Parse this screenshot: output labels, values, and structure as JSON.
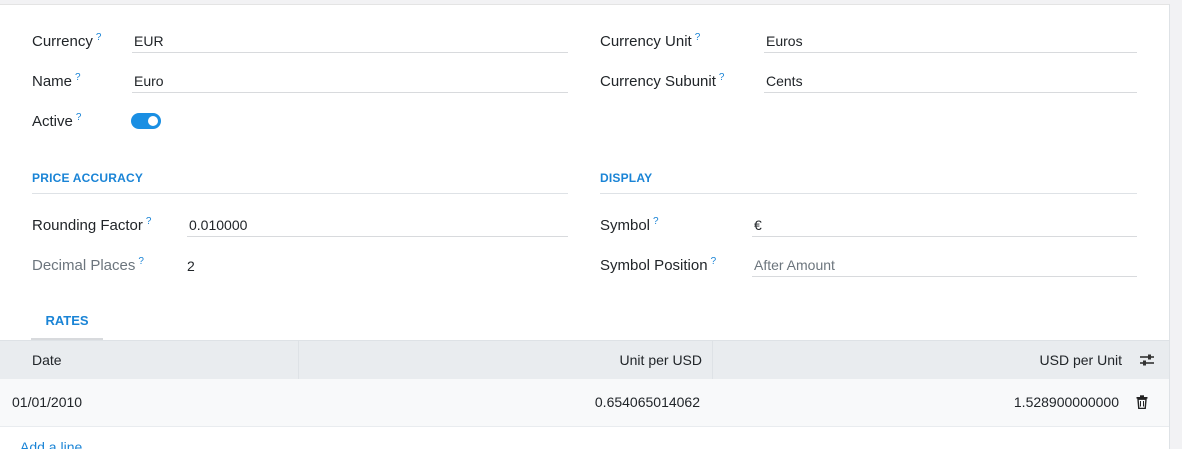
{
  "form": {
    "currency": {
      "label": "Currency",
      "help": "?",
      "value": "EUR"
    },
    "name": {
      "label": "Name",
      "help": "?",
      "value": "Euro"
    },
    "active": {
      "label": "Active",
      "help": "?",
      "value": true
    },
    "currency_unit": {
      "label": "Currency Unit",
      "help": "?",
      "value": "Euros"
    },
    "currency_subunit": {
      "label": "Currency Subunit",
      "help": "?",
      "value": "Cents"
    }
  },
  "price_accuracy": {
    "title": "PRICE ACCURACY",
    "rounding_factor": {
      "label": "Rounding Factor",
      "help": "?",
      "value": "0.010000"
    },
    "decimal_places": {
      "label": "Decimal Places",
      "help": "?",
      "value": "2"
    }
  },
  "display": {
    "title": "DISPLAY",
    "symbol": {
      "label": "Symbol",
      "help": "?",
      "value": "€"
    },
    "symbol_position": {
      "label": "Symbol Position",
      "help": "?",
      "value": "After Amount"
    }
  },
  "tabs": [
    {
      "label": "RATES"
    }
  ],
  "rates_table": {
    "columns": [
      "Date",
      "Unit per USD",
      "USD per Unit"
    ],
    "rows": [
      {
        "date": "01/01/2010",
        "unit_per_usd": "0.654065014062",
        "usd_per_unit": "1.528900000000"
      }
    ],
    "add_line": "Add a line"
  },
  "colors": {
    "accent": "#1a84d6",
    "toggle_on": "#1a8fe3",
    "header_bg": "#e9ecef"
  },
  "icons": {
    "column_settings": "sliders-icon",
    "delete": "trash-icon"
  }
}
